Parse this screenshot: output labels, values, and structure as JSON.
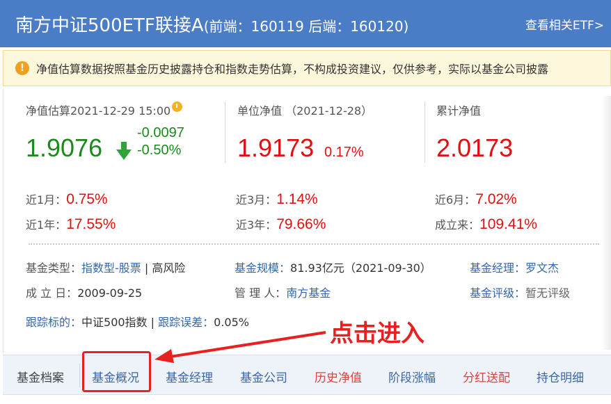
{
  "header": {
    "fund_name": "南方中证500ETF联接A",
    "codes": "(前端：160119  后端：160120)",
    "etf_link": "查看相关ETF>"
  },
  "notice": {
    "text": "净值估算数据按照基金历史披露持仓和指数走势估算，不构成投资建议，仅供参考，实际以基金公司披露"
  },
  "estimate": {
    "label": "净值估算2021-12-29 15:00",
    "value": "1.9076",
    "change": "-0.0097",
    "change_pct": "-0.50%"
  },
  "unit_nav": {
    "label": "单位净值 （2021-12-28）",
    "value": "1.9173",
    "change_pct": "0.17%"
  },
  "cum_nav": {
    "label": "累计净值",
    "value": "2.0173"
  },
  "performance": [
    {
      "label": "近1月：",
      "value": "0.75%"
    },
    {
      "label": "近3月：",
      "value": "1.14%"
    },
    {
      "label": "近6月：",
      "value": "7.02%"
    },
    {
      "label": "近1年：",
      "value": "17.55%"
    },
    {
      "label": "近3年：",
      "value": "79.66%"
    },
    {
      "label": "成立来：",
      "value": "109.41%"
    }
  ],
  "info": {
    "type_label": "基金类型：",
    "type_value": "指数型-股票",
    "type_sep": " | ",
    "risk": "高风险",
    "scale_label": "基金规模：",
    "scale_value": "81.93亿元（2021-09-30）",
    "manager_label": "基金经理：",
    "manager_value": "罗文杰",
    "inception_label": "成 立 日：",
    "inception_value": "2009-09-25",
    "admin_label": "管 理 人：",
    "admin_value": "南方基金",
    "rating_label": "基金评级：",
    "rating_value": "暂无评级",
    "track_label": "跟踪标的：",
    "track_value": "中证500指数",
    "track_sep": " | ",
    "error_label": "跟踪误差：",
    "error_value": "0.05%"
  },
  "annotation": {
    "text": "点击进入"
  },
  "tabs": [
    {
      "label": "基金档案"
    },
    {
      "label": "基金概况"
    },
    {
      "label": "基金经理"
    },
    {
      "label": "基金公司"
    },
    {
      "label": "历史净值"
    },
    {
      "label": "阶段涨幅"
    },
    {
      "label": "分红送配"
    },
    {
      "label": "持仓明细"
    }
  ],
  "colors": {
    "header_bg": "#4b7cc6",
    "up": "#e01010",
    "down": "#1a8a1a",
    "link": "#3366aa",
    "annotation": "#e82020"
  }
}
